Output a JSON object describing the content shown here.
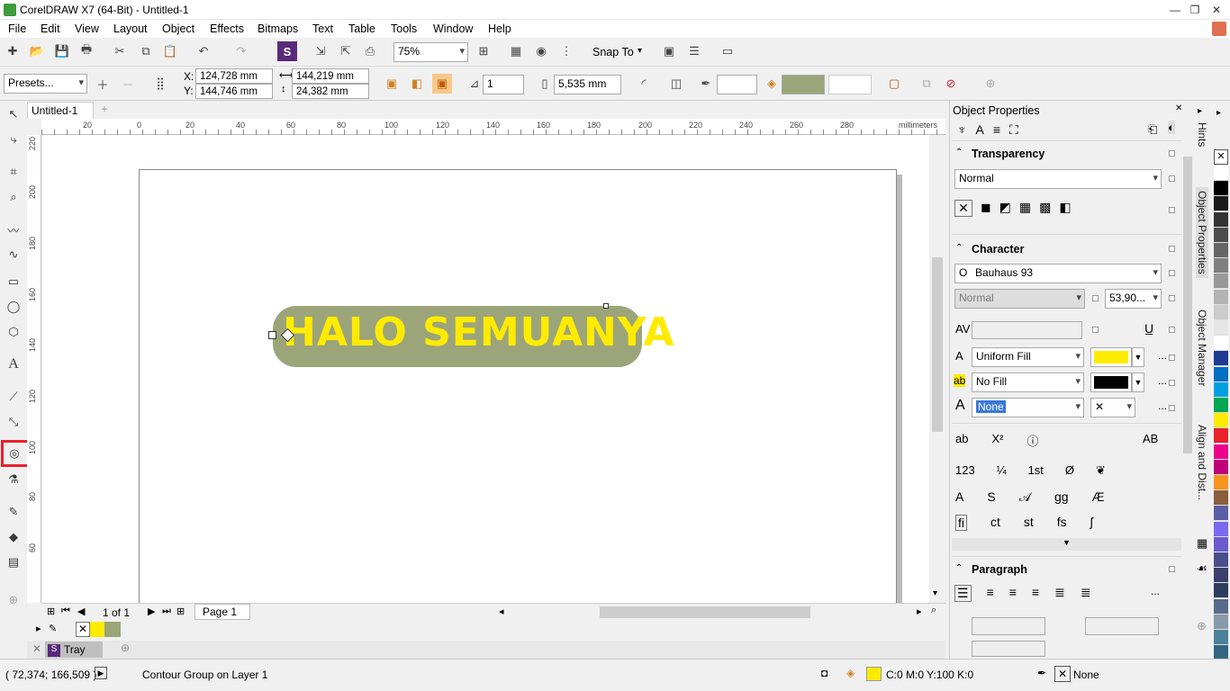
{
  "app": {
    "title": "CorelDRAW X7 (64-Bit) - Untitled-1"
  },
  "menu": [
    "File",
    "Edit",
    "View",
    "Layout",
    "Object",
    "Effects",
    "Bitmaps",
    "Text",
    "Table",
    "Tools",
    "Window",
    "Help"
  ],
  "toolbar": {
    "zoom": "75%",
    "snap_to": "Snap To"
  },
  "propbar": {
    "presets": "Presets...",
    "x": "124,728 mm",
    "y": "144,746 mm",
    "w": "144,219 mm",
    "h": "24,382 mm",
    "x_label": "X:",
    "y_label": "Y:",
    "steps": "1",
    "offset": "5,535 mm"
  },
  "doc": {
    "tab": "Untitled-1",
    "ruler_unit": "millimeters",
    "text_object": "HALO SEMUANYA",
    "hruler_ticks": [
      "20",
      "0",
      "20",
      "40",
      "60",
      "80",
      "100",
      "120",
      "140",
      "160",
      "180",
      "200",
      "220",
      "240",
      "260",
      "280"
    ],
    "vruler_ticks": [
      "220",
      "200",
      "180",
      "160",
      "140",
      "120",
      "100",
      "80",
      "60"
    ]
  },
  "pagenav": {
    "count": "1 of 1",
    "page_tab": "Page 1"
  },
  "tray": {
    "label": "Tray"
  },
  "docker": {
    "title": "Object Properties",
    "transparency": {
      "header": "Transparency",
      "mode": "Normal"
    },
    "character": {
      "header": "Character",
      "font": "Bauhaus 93",
      "style": "Normal",
      "size": "53,90...",
      "fill": "Uniform Fill",
      "bg_fill": "No Fill",
      "outline": "None"
    },
    "paragraph": {
      "header": "Paragraph"
    }
  },
  "docker_tabs": [
    "Hints",
    "Object Properties",
    "Object Manager",
    "Align and Dist..."
  ],
  "status": {
    "coords": "( 72,374; 166,509 )",
    "object": "Contour Group on Layer 1",
    "fill_color": "C:0 M:0 Y:100 K:0",
    "outline": "None"
  },
  "colors": {
    "olive": "#9ca57a",
    "yellow": "#ffeb00",
    "accent": "#3b78d8"
  },
  "palette": [
    "#ffffff",
    "#000000",
    "#1a1a1a",
    "#333333",
    "#4d4d4d",
    "#666666",
    "#808080",
    "#999999",
    "#b3b3b3",
    "#cccccc",
    "#e6e6e6",
    "#ffffff",
    "#1f3a93",
    "#0070c0",
    "#00a0e0",
    "#00a651",
    "#ffeb00",
    "#e8212b",
    "#ec008c",
    "#c0007a",
    "#f7941d",
    "#8b5e3c",
    "#5b5ea6",
    "#7b68ee",
    "#6a5acd",
    "#4b4e8c",
    "#3a3f6b",
    "#2e3c5c",
    "#5a6a8a",
    "#8899aa",
    "#4d8099",
    "#336680",
    "#00a0a0"
  ]
}
